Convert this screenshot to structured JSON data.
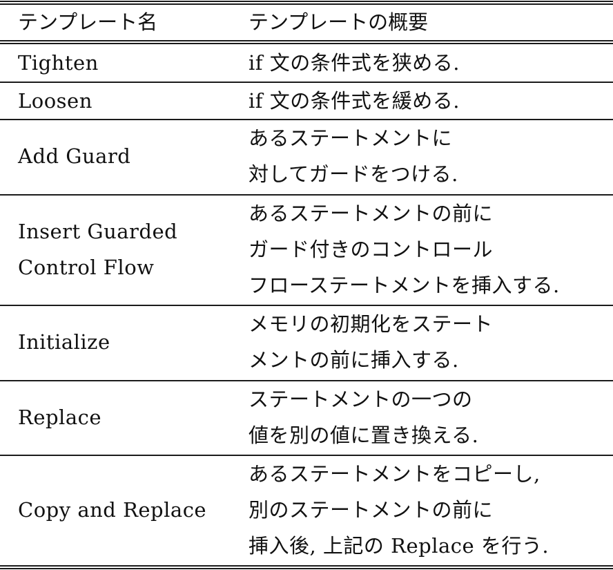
{
  "table": {
    "headers": [
      "テンプレート名",
      "テンプレートの概要"
    ],
    "rows": [
      {
        "name": [
          "Tighten"
        ],
        "description": [
          "if 文の条件式を狭める."
        ]
      },
      {
        "name": [
          "Loosen"
        ],
        "description": [
          "if 文の条件式を緩める."
        ]
      },
      {
        "name": [
          "Add Guard"
        ],
        "description": [
          "あるステートメントに",
          "対してガードをつける."
        ]
      },
      {
        "name": [
          "Insert Guarded",
          "Control Flow"
        ],
        "description": [
          "あるステートメントの前に",
          "ガード付きのコントロール",
          "フローステートメントを挿入する."
        ]
      },
      {
        "name": [
          "Initialize"
        ],
        "description": [
          "メモリの初期化をステート",
          "メントの前に挿入する."
        ]
      },
      {
        "name": [
          "Replace"
        ],
        "description": [
          "ステートメントの一つの",
          "値を別の値に置き換える."
        ]
      },
      {
        "name": [
          "Copy and Replace"
        ],
        "description": [
          "あるステートメントをコピーし,",
          "別のステートメントの前に",
          "挿入後, 上記の Replace を行う."
        ]
      }
    ]
  }
}
